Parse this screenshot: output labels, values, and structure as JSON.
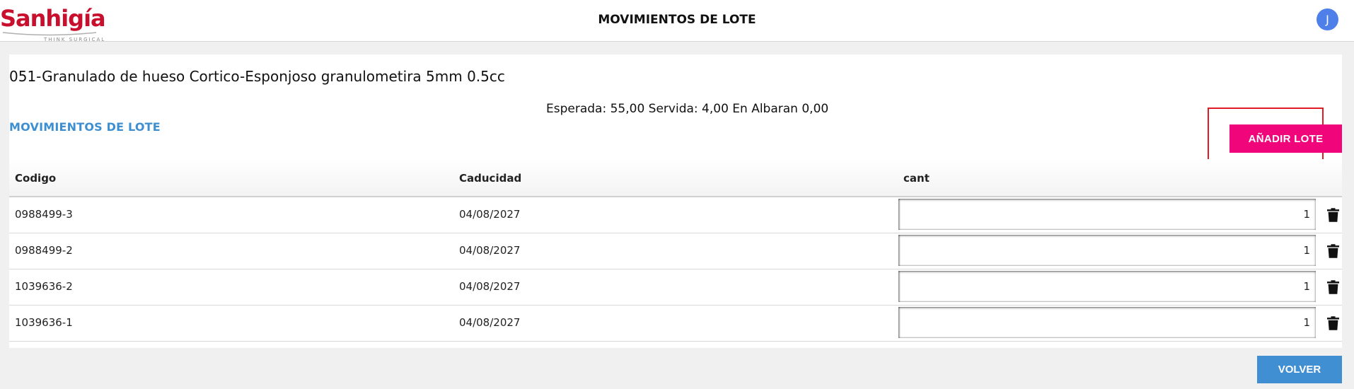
{
  "header": {
    "logo_text": "Sanhigía",
    "logo_tagline": "THINK SURGICAL",
    "title": "MOVIMIENTOS DE LOTE",
    "avatar_initial": "J",
    "brand_color": "#c8102e"
  },
  "product": {
    "title": "051-Granulado de hueso Cortico-Esponjoso granulometira 5mm 0.5cc",
    "summary": "Esperada: 55,00 Servida: 4,00 En Albaran 0,00"
  },
  "section": {
    "label": "MOVIMIENTOS DE LOTE"
  },
  "actions": {
    "add_label": "AÑADIR LOTE",
    "back_label": "VOLVER"
  },
  "table": {
    "columns": [
      "Codigo",
      "Caducidad",
      "cant"
    ],
    "rows": [
      {
        "codigo": "0988499-3",
        "caducidad": "04/08/2027",
        "cant": "1"
      },
      {
        "codigo": "0988499-2",
        "caducidad": "04/08/2027",
        "cant": "1"
      },
      {
        "codigo": "1039636-2",
        "caducidad": "04/08/2027",
        "cant": "1"
      },
      {
        "codigo": "1039636-1",
        "caducidad": "04/08/2027",
        "cant": "1"
      }
    ]
  },
  "colors": {
    "accent_pink": "#f0067a",
    "primary_blue": "#3f8fd2",
    "section_blue": "#3d8fd1",
    "highlight_red": "#e01b24"
  }
}
